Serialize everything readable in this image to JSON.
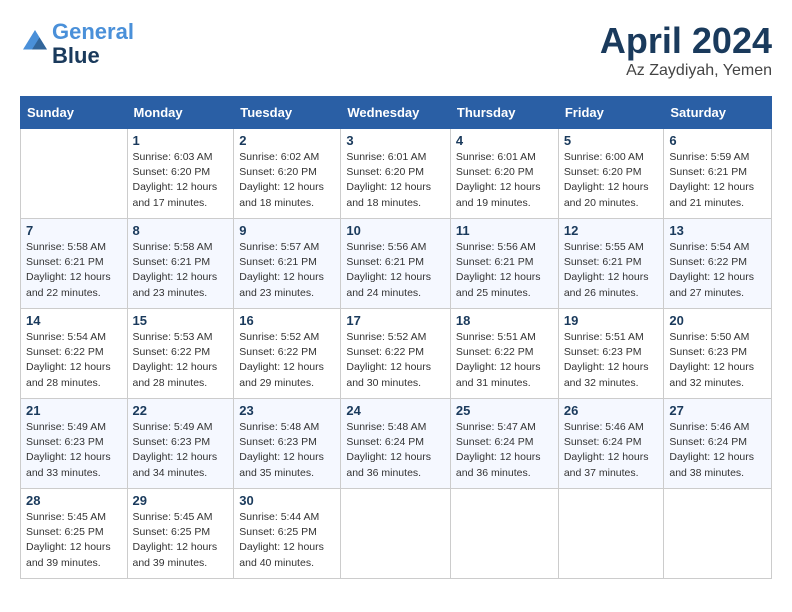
{
  "header": {
    "logo_line1": "General",
    "logo_line2": "Blue",
    "month": "April 2024",
    "location": "Az Zaydiyah, Yemen"
  },
  "columns": [
    "Sunday",
    "Monday",
    "Tuesday",
    "Wednesday",
    "Thursday",
    "Friday",
    "Saturday"
  ],
  "weeks": [
    [
      {
        "day": "",
        "info": ""
      },
      {
        "day": "1",
        "info": "Sunrise: 6:03 AM\nSunset: 6:20 PM\nDaylight: 12 hours\nand 17 minutes."
      },
      {
        "day": "2",
        "info": "Sunrise: 6:02 AM\nSunset: 6:20 PM\nDaylight: 12 hours\nand 18 minutes."
      },
      {
        "day": "3",
        "info": "Sunrise: 6:01 AM\nSunset: 6:20 PM\nDaylight: 12 hours\nand 18 minutes."
      },
      {
        "day": "4",
        "info": "Sunrise: 6:01 AM\nSunset: 6:20 PM\nDaylight: 12 hours\nand 19 minutes."
      },
      {
        "day": "5",
        "info": "Sunrise: 6:00 AM\nSunset: 6:20 PM\nDaylight: 12 hours\nand 20 minutes."
      },
      {
        "day": "6",
        "info": "Sunrise: 5:59 AM\nSunset: 6:21 PM\nDaylight: 12 hours\nand 21 minutes."
      }
    ],
    [
      {
        "day": "7",
        "info": "Sunrise: 5:58 AM\nSunset: 6:21 PM\nDaylight: 12 hours\nand 22 minutes."
      },
      {
        "day": "8",
        "info": "Sunrise: 5:58 AM\nSunset: 6:21 PM\nDaylight: 12 hours\nand 23 minutes."
      },
      {
        "day": "9",
        "info": "Sunrise: 5:57 AM\nSunset: 6:21 PM\nDaylight: 12 hours\nand 23 minutes."
      },
      {
        "day": "10",
        "info": "Sunrise: 5:56 AM\nSunset: 6:21 PM\nDaylight: 12 hours\nand 24 minutes."
      },
      {
        "day": "11",
        "info": "Sunrise: 5:56 AM\nSunset: 6:21 PM\nDaylight: 12 hours\nand 25 minutes."
      },
      {
        "day": "12",
        "info": "Sunrise: 5:55 AM\nSunset: 6:21 PM\nDaylight: 12 hours\nand 26 minutes."
      },
      {
        "day": "13",
        "info": "Sunrise: 5:54 AM\nSunset: 6:22 PM\nDaylight: 12 hours\nand 27 minutes."
      }
    ],
    [
      {
        "day": "14",
        "info": "Sunrise: 5:54 AM\nSunset: 6:22 PM\nDaylight: 12 hours\nand 28 minutes."
      },
      {
        "day": "15",
        "info": "Sunrise: 5:53 AM\nSunset: 6:22 PM\nDaylight: 12 hours\nand 28 minutes."
      },
      {
        "day": "16",
        "info": "Sunrise: 5:52 AM\nSunset: 6:22 PM\nDaylight: 12 hours\nand 29 minutes."
      },
      {
        "day": "17",
        "info": "Sunrise: 5:52 AM\nSunset: 6:22 PM\nDaylight: 12 hours\nand 30 minutes."
      },
      {
        "day": "18",
        "info": "Sunrise: 5:51 AM\nSunset: 6:22 PM\nDaylight: 12 hours\nand 31 minutes."
      },
      {
        "day": "19",
        "info": "Sunrise: 5:51 AM\nSunset: 6:23 PM\nDaylight: 12 hours\nand 32 minutes."
      },
      {
        "day": "20",
        "info": "Sunrise: 5:50 AM\nSunset: 6:23 PM\nDaylight: 12 hours\nand 32 minutes."
      }
    ],
    [
      {
        "day": "21",
        "info": "Sunrise: 5:49 AM\nSunset: 6:23 PM\nDaylight: 12 hours\nand 33 minutes."
      },
      {
        "day": "22",
        "info": "Sunrise: 5:49 AM\nSunset: 6:23 PM\nDaylight: 12 hours\nand 34 minutes."
      },
      {
        "day": "23",
        "info": "Sunrise: 5:48 AM\nSunset: 6:23 PM\nDaylight: 12 hours\nand 35 minutes."
      },
      {
        "day": "24",
        "info": "Sunrise: 5:48 AM\nSunset: 6:24 PM\nDaylight: 12 hours\nand 36 minutes."
      },
      {
        "day": "25",
        "info": "Sunrise: 5:47 AM\nSunset: 6:24 PM\nDaylight: 12 hours\nand 36 minutes."
      },
      {
        "day": "26",
        "info": "Sunrise: 5:46 AM\nSunset: 6:24 PM\nDaylight: 12 hours\nand 37 minutes."
      },
      {
        "day": "27",
        "info": "Sunrise: 5:46 AM\nSunset: 6:24 PM\nDaylight: 12 hours\nand 38 minutes."
      }
    ],
    [
      {
        "day": "28",
        "info": "Sunrise: 5:45 AM\nSunset: 6:25 PM\nDaylight: 12 hours\nand 39 minutes."
      },
      {
        "day": "29",
        "info": "Sunrise: 5:45 AM\nSunset: 6:25 PM\nDaylight: 12 hours\nand 39 minutes."
      },
      {
        "day": "30",
        "info": "Sunrise: 5:44 AM\nSunset: 6:25 PM\nDaylight: 12 hours\nand 40 minutes."
      },
      {
        "day": "",
        "info": ""
      },
      {
        "day": "",
        "info": ""
      },
      {
        "day": "",
        "info": ""
      },
      {
        "day": "",
        "info": ""
      }
    ]
  ]
}
